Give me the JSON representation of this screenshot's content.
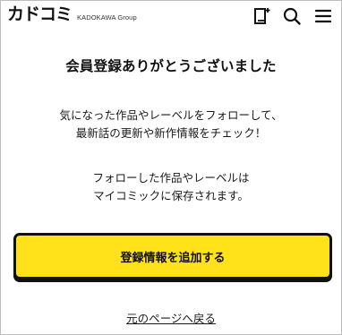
{
  "header": {
    "logo_text": "カドコミ",
    "logo_sub": "KADOKAWA Group",
    "icons": [
      "bookshelf-icon",
      "search-icon",
      "menu-icon"
    ]
  },
  "main": {
    "title": "会員登録ありがとうございました",
    "message1_line1": "気になった作品やレーベルをフォローして、",
    "message1_line2": "最新話の更新や新作情報をチェック！",
    "message2_line1": "フォローした作品やレーベルは",
    "message2_line2": "マイコミックに保存されます。",
    "cta_label": "登録情報を追加する",
    "back_link": "元のページへ戻る"
  },
  "colors": {
    "accent": "#ffe21a",
    "text": "#111111",
    "border": "#bdbdbd"
  }
}
